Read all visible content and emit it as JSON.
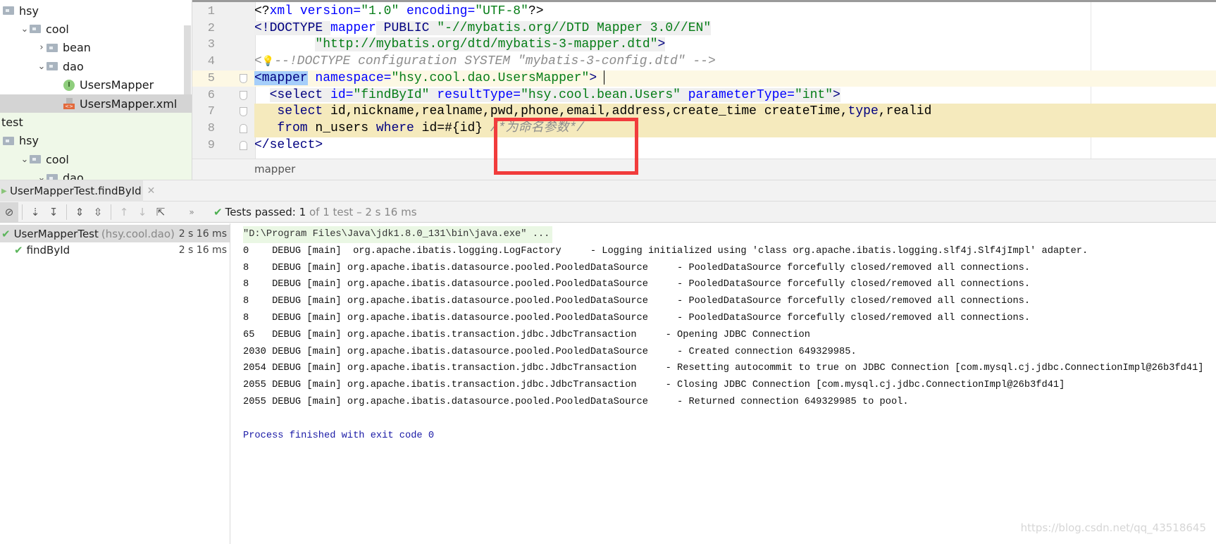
{
  "project_tree": {
    "items": [
      {
        "label": "hsy",
        "indent": 0,
        "chevron": "",
        "icon": "folder-icon"
      },
      {
        "label": "cool",
        "indent": 1,
        "chevron": "down",
        "icon": "folder-icon"
      },
      {
        "label": "bean",
        "indent": 2,
        "chevron": "right",
        "icon": "folder-icon"
      },
      {
        "label": "dao",
        "indent": 2,
        "chevron": "down",
        "icon": "folder-icon"
      },
      {
        "label": "UsersMapper",
        "indent": 3,
        "chevron": "",
        "icon": "interface-icon"
      },
      {
        "label": "UsersMapper.xml",
        "indent": 3,
        "chevron": "",
        "icon": "xml-file-icon",
        "selected": true
      },
      {
        "label": "test",
        "indent": -1,
        "chevron": "",
        "icon": ""
      },
      {
        "label": "hsy",
        "indent": 0,
        "chevron": "",
        "icon": "folder-icon"
      },
      {
        "label": "cool",
        "indent": 1,
        "chevron": "down",
        "icon": "folder-icon"
      },
      {
        "label": "dao",
        "indent": 2,
        "chevron": "down",
        "icon": "folder-icon"
      }
    ]
  },
  "editor": {
    "lines": [
      {
        "n": "1",
        "tokens": [
          [
            "<?",
            "t-pl"
          ],
          [
            "xml version=",
            "t-attr"
          ],
          [
            "\"1.0\"",
            "t-val"
          ],
          [
            " encoding=",
            "t-attr"
          ],
          [
            "\"UTF-8\"",
            "t-val"
          ],
          [
            "?>",
            "t-pl"
          ]
        ]
      },
      {
        "n": "2",
        "tokens": [
          [
            "<!DOCTYPE ",
            "t-tag gbg"
          ],
          [
            "mapper",
            "t-attr"
          ],
          [
            " PUBLIC ",
            "t-tag gbg"
          ],
          [
            "\"-//mybatis.org//DTD Mapper 3.0//EN\"",
            "t-val gbg"
          ]
        ]
      },
      {
        "n": "3",
        "tokens": [
          [
            "        ",
            "t-pl"
          ],
          [
            "\"http://mybatis.org/dtd/mybatis-3-mapper.dtd\"",
            "t-val gbg"
          ],
          [
            ">",
            "t-tag gbg"
          ]
        ]
      },
      {
        "n": "4",
        "bulb": true,
        "tokens": [
          [
            "<",
            "t-cm"
          ],
          [
            "--!DOCTYPE configuration SYSTEM \"mybatis-3-config.dtd\" -->",
            "t-cm"
          ]
        ]
      },
      {
        "n": "5",
        "current": true,
        "fold": "start",
        "tokens": [
          [
            "<mapper",
            "t-tag hl"
          ],
          [
            " namespace=",
            "t-attr"
          ],
          [
            "\"hsy.cool.dao.UsersMapper\"",
            "t-val"
          ],
          [
            ">",
            "t-tag"
          ]
        ]
      },
      {
        "n": "6",
        "fold": "start",
        "tokens": [
          [
            "  ",
            "t-pl"
          ],
          [
            "<select",
            "t-tag gbg"
          ],
          [
            " id=",
            "t-attr gbg"
          ],
          [
            "\"findById\"",
            "t-val gbg"
          ],
          [
            " resultType=",
            "t-attr gbg"
          ],
          [
            "\"hsy.cool.bean.Users\"",
            "t-val gbg"
          ],
          [
            " parameterType=",
            "t-attr gbg"
          ],
          [
            "\"int\"",
            "t-val gbg"
          ],
          [
            ">",
            "t-tag gbg"
          ]
        ]
      },
      {
        "n": "7",
        "sql": true,
        "fold": "start",
        "tokens": [
          [
            "   ",
            "t-pl"
          ],
          [
            "select",
            "t-kw"
          ],
          [
            " id,nickname,realname,pwd,phone,email,address,create_time createTime,",
            "t-pl"
          ],
          [
            "type",
            "t-kw"
          ],
          [
            ",realid",
            "t-pl"
          ]
        ]
      },
      {
        "n": "8",
        "sql": true,
        "fold": "end",
        "tokens": [
          [
            "   ",
            "t-pl"
          ],
          [
            "from",
            "t-kw"
          ],
          [
            " n_users ",
            "t-pl"
          ],
          [
            "where",
            "t-kw"
          ],
          [
            " id=#{id} ",
            "t-pl"
          ],
          [
            "/*为命名参数*/",
            "t-cm"
          ]
        ]
      },
      {
        "n": "9",
        "fold": "end",
        "tokens": [
          [
            "</select>",
            "t-tag"
          ]
        ]
      }
    ],
    "breadcrumb": "mapper"
  },
  "run_panel": {
    "tab_label": "UserMapperTest.findById",
    "status": {
      "label": "Tests passed:",
      "passed": "1",
      "of_text": "of 1 test – 2 s 16 ms"
    },
    "results": [
      {
        "label": "UserMapperTest",
        "pkg": "(hsy.cool.dao)",
        "duration": "2 s 16 ms",
        "selected": true
      },
      {
        "label": "findById",
        "pkg": "",
        "duration": "2 s 16 ms"
      }
    ],
    "console": [
      {
        "text": "\"D:\\Program Files\\Java\\jdk1.8.0_131\\bin\\java.exe\" ...",
        "kind": "cmd"
      },
      {
        "text": "0    DEBUG [main]  org.apache.ibatis.logging.LogFactory     - Logging initialized using 'class org.apache.ibatis.logging.slf4j.Slf4jImpl' adapter."
      },
      {
        "text": "8    DEBUG [main] org.apache.ibatis.datasource.pooled.PooledDataSource     - PooledDataSource forcefully closed/removed all connections."
      },
      {
        "text": "8    DEBUG [main] org.apache.ibatis.datasource.pooled.PooledDataSource     - PooledDataSource forcefully closed/removed all connections."
      },
      {
        "text": "8    DEBUG [main] org.apache.ibatis.datasource.pooled.PooledDataSource     - PooledDataSource forcefully closed/removed all connections."
      },
      {
        "text": "8    DEBUG [main] org.apache.ibatis.datasource.pooled.PooledDataSource     - PooledDataSource forcefully closed/removed all connections."
      },
      {
        "text": "65   DEBUG [main] org.apache.ibatis.transaction.jdbc.JdbcTransaction     - Opening JDBC Connection"
      },
      {
        "text": "2030 DEBUG [main] org.apache.ibatis.datasource.pooled.PooledDataSource     - Created connection 649329985."
      },
      {
        "text": "2054 DEBUG [main] org.apache.ibatis.transaction.jdbc.JdbcTransaction     - Resetting autocommit to true on JDBC Connection [com.mysql.cj.jdbc.ConnectionImpl@26b3fd41]"
      },
      {
        "text": "2055 DEBUG [main] org.apache.ibatis.transaction.jdbc.JdbcTransaction     - Closing JDBC Connection [com.mysql.cj.jdbc.ConnectionImpl@26b3fd41]"
      },
      {
        "text": "2055 DEBUG [main] org.apache.ibatis.datasource.pooled.PooledDataSource     - Returned connection 649329985 to pool."
      },
      {
        "text": "",
        "kind": "blank"
      },
      {
        "text": "Process finished with exit code 0",
        "kind": "exit"
      }
    ]
  },
  "annotation": {
    "color": "#f13c3c"
  },
  "watermark": "https://blog.csdn.net/qq_43518645"
}
